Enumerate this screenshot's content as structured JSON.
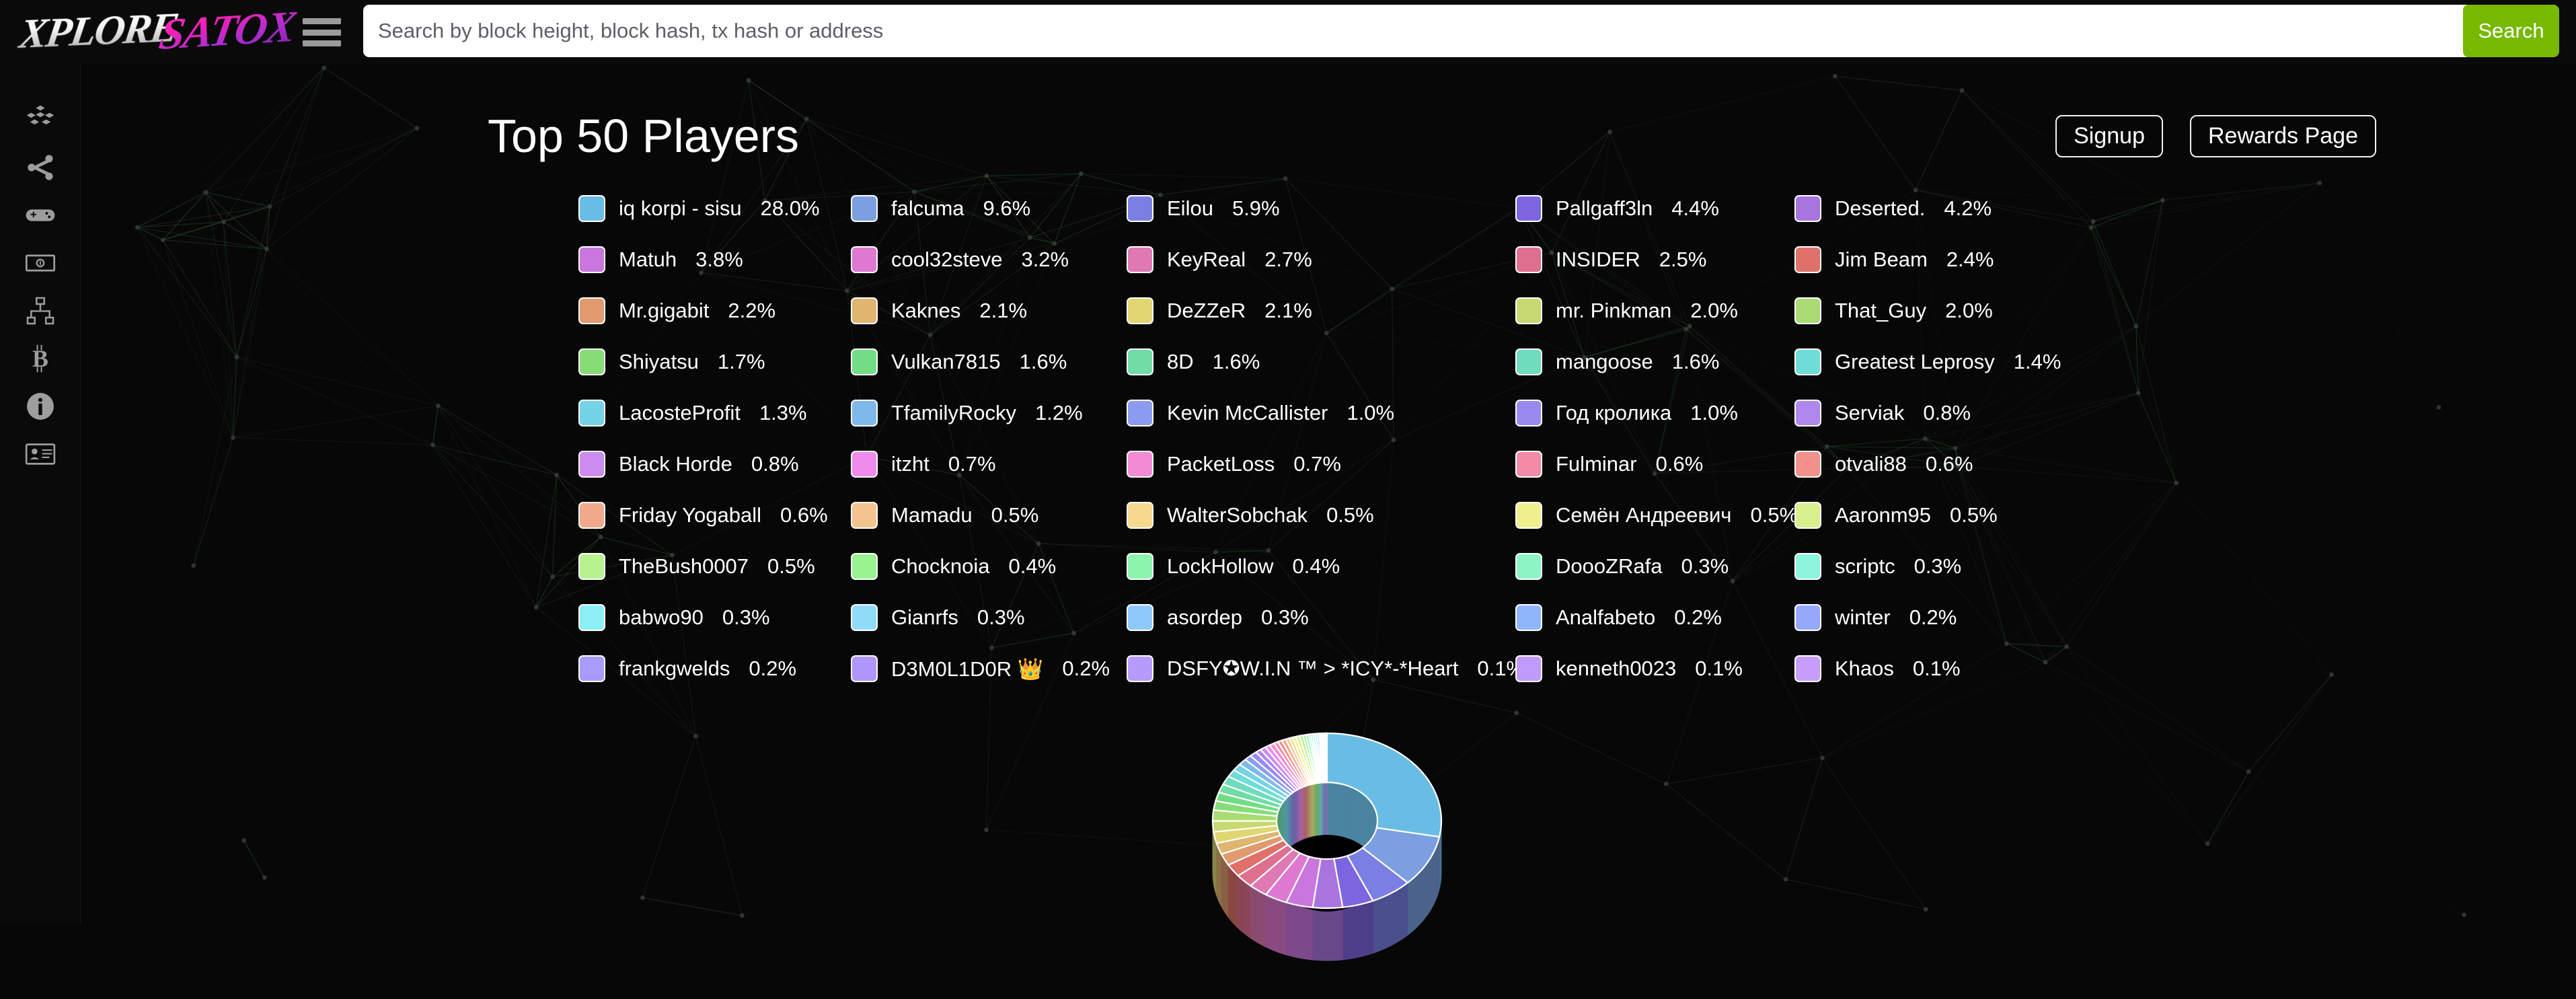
{
  "brand": {
    "logo_first": "XPLORE",
    "logo_second": "SATOX"
  },
  "search": {
    "placeholder": "Search by block height, block hash, tx hash or address",
    "value": "",
    "button_label": "Search"
  },
  "sidebar": {
    "items": [
      {
        "icon": "blocks-cubes-icon",
        "name": "sidebar-item-blocks"
      },
      {
        "icon": "share-network-icon",
        "name": "sidebar-item-network"
      },
      {
        "icon": "gamepad-icon",
        "name": "sidebar-item-games"
      },
      {
        "icon": "money-bill-icon",
        "name": "sidebar-item-money"
      },
      {
        "icon": "sitemap-icon",
        "name": "sidebar-item-sitemap"
      },
      {
        "icon": "bitcoin-icon",
        "name": "sidebar-item-bitcoin"
      },
      {
        "icon": "info-circle-icon",
        "name": "sidebar-item-info"
      },
      {
        "icon": "id-card-icon",
        "name": "sidebar-item-idcard"
      }
    ]
  },
  "header": {
    "title": "Top 50 Players",
    "signup_label": "Signup",
    "rewards_label": "Rewards Page"
  },
  "accents": {
    "search_button": "#76b900",
    "background": "#070707",
    "topbar": "#0a0a0a"
  },
  "chart_data": {
    "type": "pie",
    "title": "Top 50 Players",
    "unit": "%",
    "legend_position": "above",
    "columns": 5,
    "rows_per_column": 10,
    "labels": [
      "iq korpi - sisu",
      "falcuma",
      "Eilou",
      "Pallgaff3ln",
      "Deserted.",
      "Matuh",
      "cool32steve",
      "KeyReal",
      "INSIDER",
      "Jim Beam",
      "Mr.gigabit",
      "Kaknes",
      "DeZZeR",
      "mr. Pinkman",
      "That_Guy",
      "Shiyatsu",
      "Vulkan7815",
      "8D",
      "mangoose",
      "Greatest Leprosy",
      "LacosteProfit",
      "TfamilyRocky",
      "Kevin McCallister",
      "Год кролика",
      "Serviak",
      "Black Horde",
      "itzht",
      "PacketLoss",
      "Fulminar",
      "otvali88",
      "Friday Yogaball",
      "Mamadu",
      "WalterSobchak",
      "Семён Андреевич",
      "Aaronm95",
      "TheBush0007",
      "Chocknoia",
      "LockHollow",
      "DoooZRafa",
      "scriptc",
      "babwo90",
      "Gianrfs",
      "asordep",
      "Analfabeto",
      "winter",
      "frankgwelds",
      "D3M0L1D0R 👑",
      "DSFY✪W.I.N ™ > *ICY*-*Heart",
      "kenneth0023",
      "Khaos"
    ],
    "values": [
      28.0,
      9.6,
      5.9,
      4.4,
      4.2,
      3.8,
      3.2,
      2.7,
      2.5,
      2.4,
      2.2,
      2.1,
      2.1,
      2.0,
      2.0,
      1.7,
      1.6,
      1.6,
      1.6,
      1.4,
      1.3,
      1.2,
      1.0,
      1.0,
      0.8,
      0.8,
      0.7,
      0.7,
      0.6,
      0.6,
      0.6,
      0.5,
      0.5,
      0.5,
      0.5,
      0.5,
      0.4,
      0.4,
      0.3,
      0.3,
      0.3,
      0.3,
      0.3,
      0.2,
      0.2,
      0.2,
      0.2,
      0.1,
      0.1,
      0.1
    ],
    "colors": [
      "#69bde4",
      "#7b9fe0",
      "#7b7fe4",
      "#7d65df",
      "#a974de",
      "#c976de",
      "#de78d0",
      "#df79b4",
      "#df6f8e",
      "#df7169",
      "#e09a6e",
      "#dfb56f",
      "#e0d672",
      "#c8d872",
      "#aada72",
      "#86dd78",
      "#72dd85",
      "#6fdda5",
      "#6edcbd",
      "#6fdcd8",
      "#74d3e6",
      "#7fb9ea",
      "#8a9bf0",
      "#9a8af0",
      "#b087ef",
      "#cb8bef",
      "#ef8bec",
      "#f28bd3",
      "#f28ba6",
      "#f2908b",
      "#f2a98b",
      "#f4c48f",
      "#f6d98f",
      "#eff08d",
      "#d7f08d",
      "#b8f28d",
      "#97f48f",
      "#8df4ad",
      "#8df4c6",
      "#8df4de",
      "#8deff6",
      "#8fdcf8",
      "#8fc9f9",
      "#8fb6fa",
      "#96a8fb",
      "#a79bfb",
      "#b095fb",
      "#b79bfc",
      "#c09bfc",
      "#c79dfc"
    ]
  }
}
